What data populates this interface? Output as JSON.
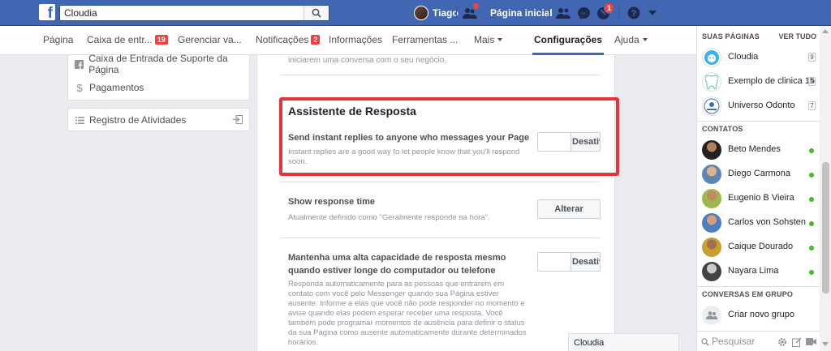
{
  "topbar": {
    "logo": "f",
    "search_value": "Cloudia",
    "user_name": "Tiago",
    "home_label": "Página inicial",
    "notifications_count": "1"
  },
  "page_nav": {
    "items": [
      {
        "label": "Página"
      },
      {
        "label": "Caixa de entr...",
        "badge": "19"
      },
      {
        "label": "Gerenciar va..."
      },
      {
        "label": "Notificações",
        "badge": "2"
      },
      {
        "label": "Informações"
      },
      {
        "label": "Ferramentas ..."
      },
      {
        "label": "Mais"
      },
      {
        "label": "Configurações"
      },
      {
        "label": "Ajuda"
      }
    ]
  },
  "left_menu": {
    "items": [
      {
        "label": "Caixa de Entrada de Suporte da Página"
      },
      {
        "label": "Pagamentos"
      },
      {
        "label": "Registro de Atividades"
      }
    ]
  },
  "main": {
    "top_desc": "iniciarem uma conversa com o seu negócio.",
    "assistant": {
      "title": "Assistente de Resposta",
      "option_title": "Send instant replies to anyone who messages your Page",
      "option_desc": "Instant replies are a good way to let people know that you'll respond soon.",
      "toggle_label": "Desativado"
    },
    "response_time": {
      "title": "Show response time",
      "desc": "Atualmente definido como \"Geralmente responde na hora\".",
      "button": "Alterar"
    },
    "away": {
      "title": "Mantenha uma alta capacidade de resposta mesmo quando estiver longe do computador ou telefone",
      "desc": "Responda automaticamente para as pessoas que entrarem em contato com você pelo Messenger quando sua Página estiver ausente. Informe a elas que você não pode responder no momento e avise quando elas podem esperar receber uma resposta. Você também pode programar momentos de ausência para definir o status da sua Página como ausente automaticamente durante determinados horários.",
      "toggle_label": "Desativado"
    }
  },
  "chat_tab": {
    "label": "Cloudia"
  },
  "sidebar": {
    "pages_header": "SUAS PÁGINAS",
    "see_all": "VER TUDO",
    "pages": [
      {
        "name": "Cloudia",
        "count": "9"
      },
      {
        "name": "Exemplo de clinica 15",
        "count": "9"
      },
      {
        "name": "Universo Odonto",
        "count": "7"
      }
    ],
    "contacts_header": "CONTATOS",
    "contacts": [
      {
        "name": "Beto Mendes"
      },
      {
        "name": "Diego Carmona"
      },
      {
        "name": "Eugenio B Vieira"
      },
      {
        "name": "Carlos von Sohsten"
      },
      {
        "name": "Caique Dourado"
      },
      {
        "name": "Nayara Lima"
      }
    ],
    "groups_header": "CONVERSAS EM GRUPO",
    "create_group": "Criar novo grupo",
    "search_placeholder": "Pesquisar"
  },
  "colors": {
    "brand_blue": "#4267b2",
    "highlight_red": "#e4353d",
    "online_green": "#42b72a",
    "badge_red": "#fa3e3e"
  }
}
